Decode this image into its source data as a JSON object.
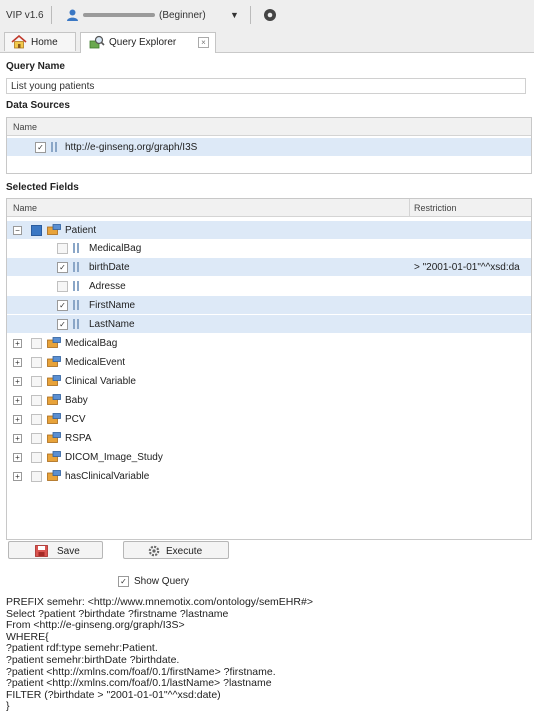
{
  "topbar": {
    "version": "VIP v1.6",
    "user_level": "(Beginner)",
    "dropdown_caret": "▼"
  },
  "tabs": [
    {
      "label": "Home"
    },
    {
      "label": "Query Explorer",
      "close": "×"
    }
  ],
  "query_name": {
    "title": "Query Name",
    "value": "List young patients"
  },
  "data_sources": {
    "title": "Data Sources",
    "header": "Name",
    "items": [
      {
        "label": "http://e-ginseng.org/graph/I3S",
        "checked": true
      }
    ]
  },
  "selected_fields": {
    "title": "Selected Fields",
    "headers": {
      "name": "Name",
      "restriction": "Restriction"
    },
    "patient": {
      "label": "Patient",
      "expander": "−",
      "fields": [
        {
          "label": "MedicalBag",
          "checked": false,
          "restriction": ""
        },
        {
          "label": "birthDate",
          "checked": true,
          "restriction": "> \"2001-01-01\"^^xsd:da"
        },
        {
          "label": "Adresse",
          "checked": false,
          "restriction": ""
        },
        {
          "label": "FirstName",
          "checked": true,
          "restriction": ""
        },
        {
          "label": "LastName",
          "checked": true,
          "restriction": ""
        }
      ]
    },
    "classes": [
      {
        "label": "MedicalBag",
        "expander": "+"
      },
      {
        "label": "MedicalEvent",
        "expander": "+"
      },
      {
        "label": "Clinical Variable",
        "expander": "+"
      },
      {
        "label": "Baby",
        "expander": "+"
      },
      {
        "label": "PCV",
        "expander": "+"
      },
      {
        "label": "RSPA",
        "expander": "+"
      },
      {
        "label": "DICOM_Image_Study",
        "expander": "+"
      },
      {
        "label": "hasClinicalVariable",
        "expander": "+"
      }
    ]
  },
  "buttons": {
    "save": "Save",
    "execute": "Execute"
  },
  "show_query": {
    "label": "Show Query",
    "checked": true
  },
  "check_mark": "✓",
  "query_text": "PREFIX semehr: <http://www.mnemotix.com/ontology/semEHR#>\nSelect ?patient ?birthdate ?firstname ?lastname\nFrom <http://e-ginseng.org/graph/I3S>\nWHERE{\n?patient rdf:type semehr:Patient.\n?patient semehr:birthDate ?birthdate.\n?patient <http://xmlns.com/foaf/0.1/firstName> ?firstname.\n?patient <http://xmlns.com/foaf/0.1/lastName> ?lastname\nFILTER (?birthdate > \"2001-01-01\"^^xsd:date)\n}"
}
